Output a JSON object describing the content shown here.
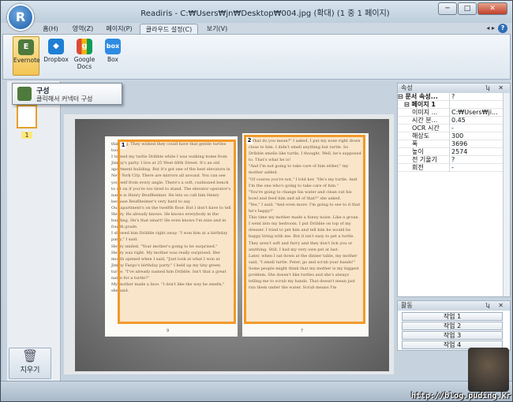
{
  "window": {
    "app_icon_letter": "R",
    "title": "Readiris - C:₩Users₩jn₩Desktop₩004.jpg (확대) (1 중 1 페이지)",
    "buttons": {
      "minimize": "─",
      "maximize": "□",
      "close": "✕"
    }
  },
  "tabs": [
    {
      "label": "홈(H)",
      "active": false
    },
    {
      "label": "영역(Z)",
      "active": false
    },
    {
      "label": "페이지(P)",
      "active": false
    },
    {
      "label": "클라우드 설정(C)",
      "active": true
    },
    {
      "label": "보기(V)",
      "active": false
    }
  ],
  "tab_arrows": "◂ ▸",
  "help_label": "?",
  "ribbon": {
    "buttons": [
      {
        "label": "Evernote",
        "icon": "evernote-icon",
        "color": "#4e7a3d",
        "selected": true
      },
      {
        "label": "Dropbox",
        "icon": "dropbox-icon",
        "color": "#1f7fd3",
        "selected": false
      },
      {
        "label": "Google Docs",
        "icon": "google-docs-icon",
        "color": "#dd4b39",
        "selected": false
      },
      {
        "label": "Box",
        "icon": "box-icon",
        "color": "#2f8ce3",
        "selected": false
      }
    ],
    "icon_glyphs": {
      "evernote": "E",
      "dropbox": "◆",
      "google": "g",
      "box": "box"
    }
  },
  "tooltip": {
    "title": "구성",
    "description": "클릭해서 커넥터 구성"
  },
  "left_panel": {
    "page_number": "1",
    "trash_label": "지우기",
    "trash_glyph": "🗑"
  },
  "document": {
    "zones": [
      {
        "number": "1"
      },
      {
        "number": "2"
      }
    ],
    "left_page_text": "thinking. They wished they could have that gentle turtles too.\nI turned my turtle Dribble while I was walking home from Jimmy's party. I live at 25 West 68th Street. It's an old apartment building. But it's got one of the best elevators in New York City. There are mirrors all around. You can see yourself from every angle. There's a soft, cushioned bench to sit on if you're too tired to stand. The elevator operator's name is Henry Beuflheimer. He lets us call him Henry because Beuflheimer's very hard to say.\nOur apartment's on the twelfth floor. But I don't have to tell Henry. He already knows. He knows everybody in the building. He's that smart! He even knows I'm nine and in fourth grade.\nI showed him Dribble right away. \"I won him at a birthday party,\" I said.\nHenry smiled. \"Your mother's going to be surprised.\"\nHenry was right. My mother was really surprised. Her mouth opened when I said, \"Just look at what I won at Jimmy Fargo's birthday party.\" I held up my tiny green turtle. \"I've already named him Dribble. Isn't that a great name for a turtle?\"\nMy mother made a face. \"I don't like the way he smells,\" she said.",
    "right_page_text": "\"What do you mean?\" I asked. I put my nose right down close to him. I didn't smell anything but turtle. So Dribble smells like turtle, I thought. Well, he's supposed to. That's what he is!\n\"And I'm not going to take care of him either,\" my mother added.\n\"Of course you're not,\" I told her. \"He's my turtle. And I'm the one who's going to take care of him.\"\n\"You're going to change his water and clean out his bowl and feed him and all of that?\" she asked.\n\"Yes,\" I said. \"And even more. I'm going to see to it that he's happy!\"\nThis time my mother made a funny noise. Like a groan.\nI went into my bedroom. I put Dribble on top of my dresser. I tried to pet him and tell him he would be happy living with me. But it isn't easy to pet a turtle. They aren't soft and furry and they don't lick you or anything. Still, I had my very own pet at last.\nLater, when I sat down at the dinner table, my mother said, \"I smell turtle. Peter, go and scrub your hands!\"\nSome people might think that my mother is my biggest problem. She doesn't like turtles and she's always telling me to scrub my hands. That doesn't mean just run them under the water. Scrub means I'm",
    "left_page_no": "9",
    "right_page_no": "7"
  },
  "properties": {
    "header": "속성",
    "controls": "ʮ ✕",
    "rows": [
      {
        "key": "⊟ 문서 속성...",
        "value": "?",
        "indent": 0,
        "bold": true
      },
      {
        "key": "⊟ 페이지 1",
        "value": "",
        "indent": 8,
        "bold": true
      },
      {
        "key": "이미지 ...",
        "value": "C:₩Users₩ji...",
        "indent": 18
      },
      {
        "key": "시간 분...",
        "value": "0.45",
        "indent": 18
      },
      {
        "key": "OCR 시간",
        "value": "-",
        "indent": 18
      },
      {
        "key": "해상도",
        "value": "300",
        "indent": 18
      },
      {
        "key": "폭",
        "value": "3696",
        "indent": 18
      },
      {
        "key": "높이",
        "value": "2574",
        "indent": 18
      },
      {
        "key": "전 기울기",
        "value": "?",
        "indent": 18
      },
      {
        "key": "회전",
        "value": "-",
        "indent": 18
      }
    ]
  },
  "activity": {
    "header": "활동",
    "controls": "ʮ ✕",
    "jobs": [
      "작업 1",
      "작업 2",
      "작업 3",
      "작업 4"
    ]
  },
  "watermark": "http://blog.puding.kr"
}
